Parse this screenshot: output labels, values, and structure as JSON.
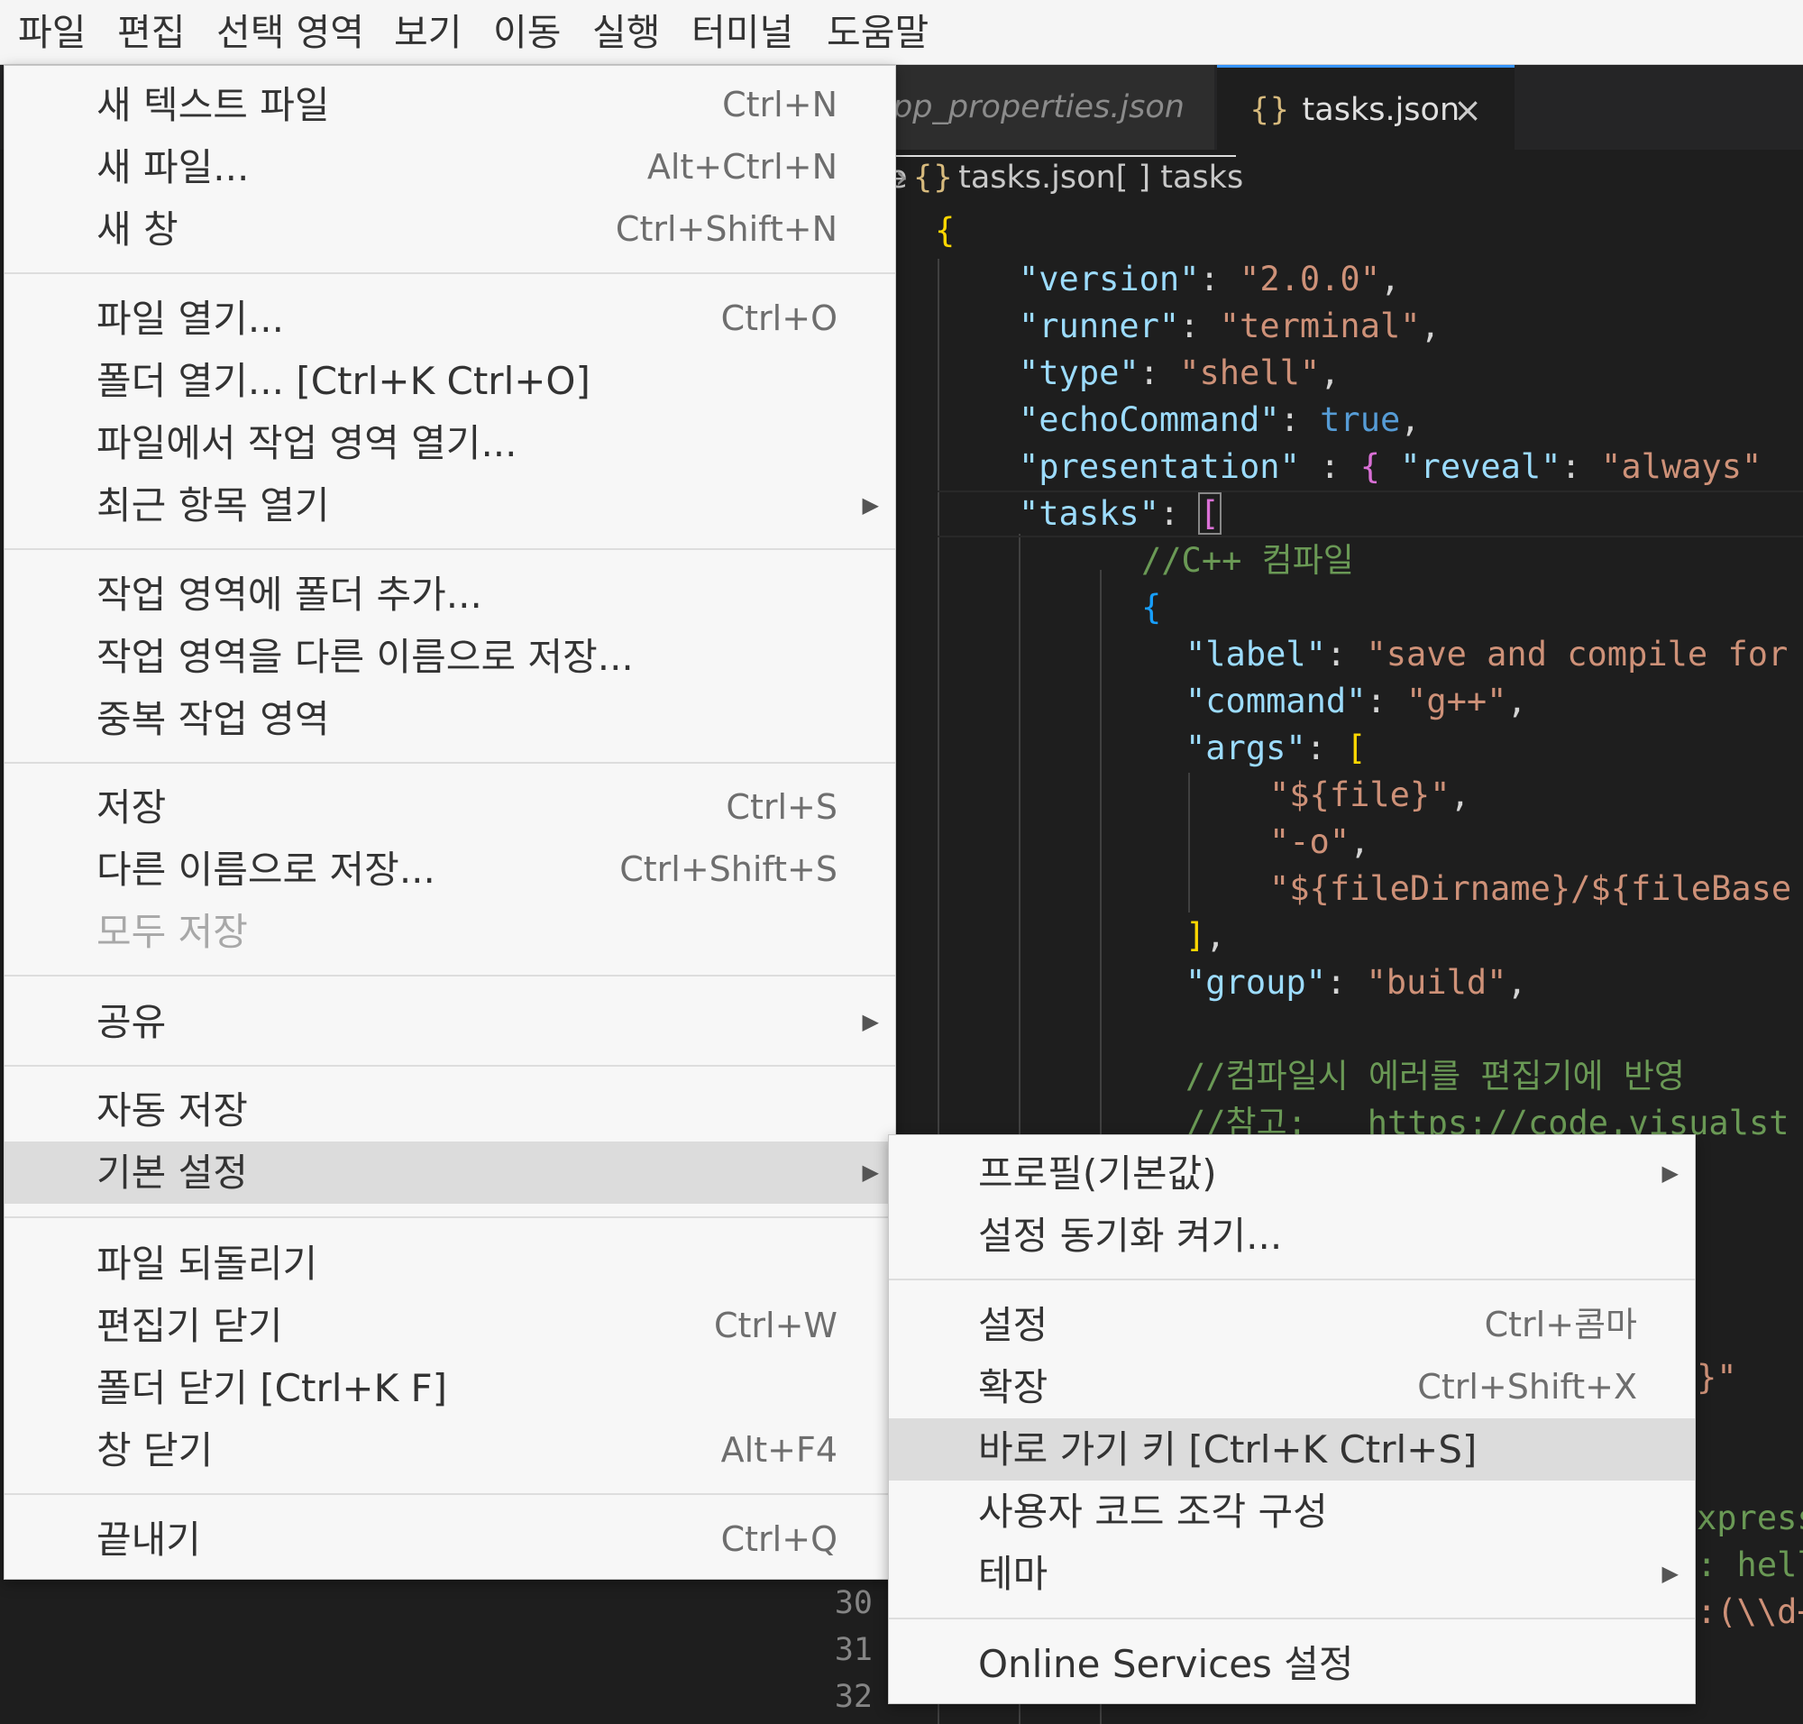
{
  "menubar": [
    "파일",
    "편집",
    "선택 영역",
    "보기",
    "이동",
    "실행",
    "터미널",
    "도움말"
  ],
  "tabs": {
    "inactive": "pp_properties.json",
    "active": "tasks.json",
    "active_icon": "{}",
    "close_icon": "×"
  },
  "breadcrumb": {
    "frag": "e",
    "sep": "›",
    "file_icon": "{}",
    "file": "tasks.json",
    "node_icon": "[ ]",
    "node": "tasks"
  },
  "code": {
    "l1": "{",
    "version_key": "\"version\"",
    "version_val": "\"2.0.0\"",
    "runner_key": "\"runner\"",
    "runner_val": "\"terminal\"",
    "type_key": "\"type\"",
    "type_val": "\"shell\"",
    "echo_key": "\"echoCommand\"",
    "echo_val": "true",
    "pres_key": "\"presentation\"",
    "pres_open": "{",
    "reveal_key": "\"reveal\"",
    "reveal_val": "\"always\"",
    "tasks_key": "\"tasks\"",
    "tasks_open": "[",
    "comment_cpp": "//C++ 컴파일",
    "obj_open": "{",
    "label_key": "\"label\"",
    "label_val": "\"save and compile for",
    "command_key": "\"command\"",
    "command_val": "\"g++\"",
    "args_key": "\"args\"",
    "args_open": "[",
    "arg1": "\"${file}\"",
    "arg2": "\"-o\"",
    "arg3": "\"${fileDirname}/${fileBase",
    "args_close": "]",
    "group_key": "\"group\"",
    "group_val": "\"build\"",
    "comment_err": "//컴파일시 에러를 편집기에 반영",
    "comment_ref": "//참고:   https://code.visualst",
    "peek1": "}\"",
    "peek2": "xpress",
    "peek3": ": hell",
    "peek4": ":(\\\\d+"
  },
  "line_numbers": [
    "30",
    "31",
    "32"
  ],
  "file_menu": {
    "new_text_file": {
      "label": "새 텍스트 파일",
      "shortcut": "Ctrl+N"
    },
    "new_file": {
      "label": "새 파일...",
      "shortcut": "Alt+Ctrl+N"
    },
    "new_window": {
      "label": "새 창",
      "shortcut": "Ctrl+Shift+N"
    },
    "open_file": {
      "label": "파일 열기...",
      "shortcut": "Ctrl+O"
    },
    "open_folder": {
      "label": "폴더 열기... [Ctrl+K Ctrl+O]"
    },
    "open_workspace": {
      "label": "파일에서 작업 영역 열기..."
    },
    "open_recent": {
      "label": "최근 항목 열기"
    },
    "add_folder": {
      "label": "작업 영역에 폴더 추가..."
    },
    "save_workspace_as": {
      "label": "작업 영역을 다른 이름으로 저장..."
    },
    "duplicate_workspace": {
      "label": "중복 작업 영역"
    },
    "save": {
      "label": "저장",
      "shortcut": "Ctrl+S"
    },
    "save_as": {
      "label": "다른 이름으로 저장...",
      "shortcut": "Ctrl+Shift+S"
    },
    "save_all": {
      "label": "모두 저장"
    },
    "share": {
      "label": "공유"
    },
    "auto_save": {
      "label": "자동 저장"
    },
    "preferences": {
      "label": "기본 설정"
    },
    "revert_file": {
      "label": "파일 되돌리기"
    },
    "close_editor": {
      "label": "편집기 닫기",
      "shortcut": "Ctrl+W"
    },
    "close_folder": {
      "label": "폴더 닫기 [Ctrl+K F]"
    },
    "close_window": {
      "label": "창 닫기",
      "shortcut": "Alt+F4"
    },
    "exit": {
      "label": "끝내기",
      "shortcut": "Ctrl+Q"
    }
  },
  "preferences_menu": {
    "profile": {
      "label": "프로필(기본값)"
    },
    "settings_sync": {
      "label": "설정 동기화 켜기..."
    },
    "settings": {
      "label": "설정",
      "shortcut": "Ctrl+콤마"
    },
    "extensions": {
      "label": "확장",
      "shortcut": "Ctrl+Shift+X"
    },
    "keybindings": {
      "label": "바로 가기 키 [Ctrl+K Ctrl+S]"
    },
    "user_snippets": {
      "label": "사용자 코드 조각 구성"
    },
    "theme": {
      "label": "테마"
    },
    "online_services": {
      "label": "Online Services 설정"
    }
  },
  "submenu_arrow": "▶",
  "colors": {
    "menu_bg": "#f7f7f7",
    "menu_highlight": "#dcdcdc",
    "editor_bg": "#1e1e1e",
    "active_tab_accent": "#3794ff"
  }
}
